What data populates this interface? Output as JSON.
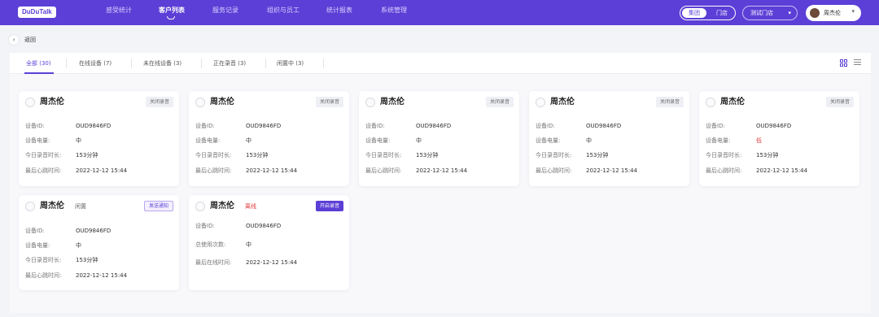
{
  "app": {
    "logo": "DuDuTalk"
  },
  "nav": {
    "items": [
      "感受统计",
      "客户列表",
      "服务记录",
      "组织与员工",
      "统计报表",
      "系统管理"
    ]
  },
  "header": {
    "toggle": [
      "集团",
      "门店"
    ],
    "store_select": "测试门店",
    "user_name": "周杰伦"
  },
  "back": {
    "label": "返回"
  },
  "tabs": [
    {
      "label": "全部 (30)"
    },
    {
      "label": "在线设备 (7)"
    },
    {
      "label": "未在线设备 (3)"
    },
    {
      "label": "正在录音 (3)"
    },
    {
      "label": "闲置中 (3)"
    }
  ],
  "colors": {
    "brand": "#5b3fd6",
    "danger": "#e23b3b"
  },
  "cards": [
    {
      "name": "周杰伦",
      "status": "",
      "action": "关闭录音",
      "rows": [
        {
          "label": "设备ID:",
          "value": "OUD9846FD"
        },
        {
          "label": "设备电量:",
          "value": "中"
        },
        {
          "label": "今日录音时长:",
          "value": "153分钟"
        },
        {
          "label": "最后心跳时间:",
          "value": "2022-12-12   15:44"
        }
      ]
    },
    {
      "name": "周杰伦",
      "status": "",
      "action": "关闭录音",
      "rows": [
        {
          "label": "设备ID:",
          "value": "OUD9846FD"
        },
        {
          "label": "设备电量:",
          "value": "中"
        },
        {
          "label": "今日录音时长:",
          "value": "153分钟"
        },
        {
          "label": "最后心跳时间:",
          "value": "2022-12-12   15:44"
        }
      ]
    },
    {
      "name": "周杰伦",
      "status": "",
      "action": "关闭录音",
      "rows": [
        {
          "label": "设备ID:",
          "value": "OUD9846FD"
        },
        {
          "label": "设备电量:",
          "value": "中"
        },
        {
          "label": "今日录音时长:",
          "value": "153分钟"
        },
        {
          "label": "最后心跳时间:",
          "value": "2022-12-12   15:44"
        }
      ]
    },
    {
      "name": "周杰伦",
      "status": "",
      "action": "关闭录音",
      "rows": [
        {
          "label": "设备ID:",
          "value": "OUD9846FD"
        },
        {
          "label": "设备电量:",
          "value": "中"
        },
        {
          "label": "今日录音时长:",
          "value": "153分钟"
        },
        {
          "label": "最后心跳时间:",
          "value": "2022-12-12   15:44"
        }
      ]
    },
    {
      "name": "周杰伦",
      "status": "",
      "action": "关闭录音",
      "rows": [
        {
          "label": "设备ID:",
          "value": "OUD9846FD"
        },
        {
          "label": "设备电量:",
          "value": "低"
        },
        {
          "label": "今日录音时长:",
          "value": "153分钟"
        },
        {
          "label": "最后心跳时间:",
          "value": "2022-12-12   15:44"
        }
      ]
    },
    {
      "name": "周杰伦",
      "status": "闲置",
      "action": "发送通知",
      "rows": [
        {
          "label": "设备ID:",
          "value": "OUD9846FD"
        },
        {
          "label": "设备电量:",
          "value": "中"
        },
        {
          "label": "今日录音时长:",
          "value": "153分钟"
        },
        {
          "label": "最后心跳时间:",
          "value": "2022-12-12   15:44"
        }
      ]
    },
    {
      "name": "周杰伦",
      "status": "离线",
      "action": "开启录音",
      "rows": [
        {
          "label": "设备ID:",
          "value": "OUD9846FD"
        },
        {
          "label": "总使用次数:",
          "value": "中"
        },
        {
          "label": "最后在线时间:",
          "value": "2022-12-12   15:44"
        }
      ]
    }
  ]
}
